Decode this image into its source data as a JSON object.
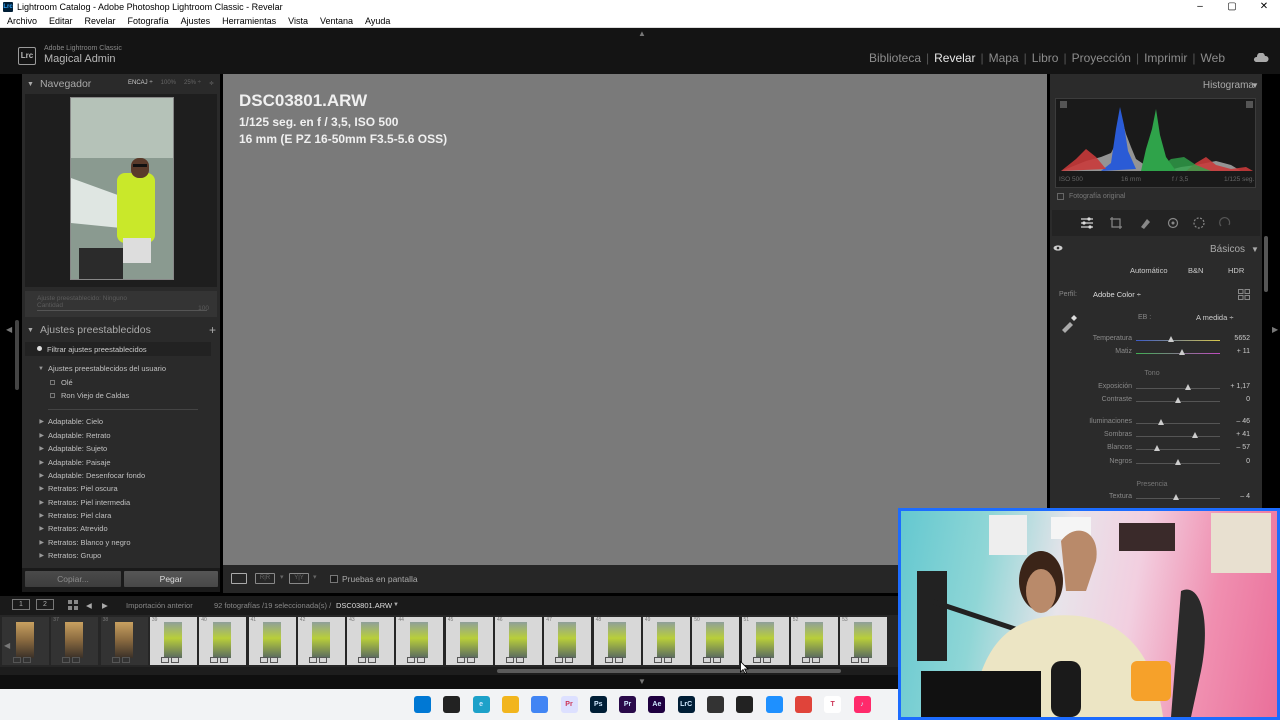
{
  "window": {
    "title": "Lightroom Catalog - Adobe Photoshop Lightroom Classic - Revelar",
    "app_icon": "Lrc",
    "controls": [
      "–",
      "▢",
      "✕"
    ]
  },
  "menu": [
    "Archivo",
    "Editar",
    "Revelar",
    "Fotografía",
    "Ajustes",
    "Herramientas",
    "Vista",
    "Ventana",
    "Ayuda"
  ],
  "identity": {
    "badge": "Lrc",
    "subtitle": "Adobe Lightroom Classic",
    "name": "Magical Admin"
  },
  "modules": [
    "Biblioteca",
    "Revelar",
    "Mapa",
    "Libro",
    "Proyección",
    "Imprimir",
    "Web"
  ],
  "active_module": "Revelar",
  "navigator": {
    "title": "Navegador",
    "zoom_options": [
      "ENCAJ ÷",
      "100%",
      "25% ÷"
    ]
  },
  "preset_amount": {
    "label1": "Ajuste preestablecido:",
    "value1": "Ninguno",
    "label2": "Cantidad",
    "value2": "100"
  },
  "presets": {
    "title": "Ajustes preestablecidos",
    "add": "+",
    "filter": "Filtrar ajustes preestablecidos",
    "user_group": "Ajustes preestablecidos del usuario",
    "user_items": [
      "Olé",
      "Ron Viejo de Caldas"
    ],
    "groups": [
      "Adaptable: Cielo",
      "Adaptable: Retrato",
      "Adaptable: Sujeto",
      "Adaptable: Paisaje",
      "Adaptable: Desenfocar fondo",
      "Retratos: Piel oscura",
      "Retratos: Piel intermedia",
      "Retratos: Piel clara",
      "Retratos: Atrevido",
      "Retratos: Blanco y negro",
      "Retratos: Grupo"
    ]
  },
  "buttons": {
    "copy": "Copiar...",
    "paste": "Pegar"
  },
  "photo_info": {
    "filename": "DSC03801.ARW",
    "exposure": "1/125 seg. en f / 3,5, ISO 500",
    "lens": "16 mm (E PZ 16-50mm F3.5-5.6 OSS)"
  },
  "toolbar": {
    "proof_label": "Pruebas en pantalla",
    "view_buttons": [
      "▭",
      "R|R",
      "Y|Y"
    ]
  },
  "histogram": {
    "title": "Histograma",
    "info": [
      "ISO 500",
      "16 mm",
      "f / 3,5",
      "1/125 seg."
    ],
    "original_photo": "Fotografía original"
  },
  "basic": {
    "title": "Básicos",
    "modes": [
      "Automático",
      "B&N",
      "HDR"
    ],
    "profile_label": "Perfil:",
    "profile_value": "Adobe Color ÷",
    "wb_label": "EB :",
    "wb_value": "A medida ÷",
    "tone_label": "Tono",
    "presence_label": "Presencia",
    "sliders": [
      {
        "label": "Temperatura",
        "value": "5652",
        "pos": 0.42
      },
      {
        "label": "Matiz",
        "value": "+ 11",
        "pos": 0.55
      },
      {
        "label": "Exposición",
        "value": "+ 1,17",
        "pos": 0.62
      },
      {
        "label": "Contraste",
        "value": "0",
        "pos": 0.5
      },
      {
        "label": "Iluminaciones",
        "value": "– 46",
        "pos": 0.3
      },
      {
        "label": "Sombras",
        "value": "+ 41",
        "pos": 0.7
      },
      {
        "label": "Blancos",
        "value": "– 57",
        "pos": 0.25
      },
      {
        "label": "Negros",
        "value": "0",
        "pos": 0.5
      },
      {
        "label": "Textura",
        "value": "– 4",
        "pos": 0.48
      }
    ]
  },
  "filmstrip": {
    "source": "Importación anterior",
    "count": "92 fotografías /19 seleccionada(s) /",
    "current": "DSC03801.ARW",
    "views": [
      "1",
      "2"
    ],
    "numbers": [
      "",
      "37",
      "38",
      "39",
      "40",
      "41",
      "42",
      "43",
      "44",
      "45",
      "46",
      "47",
      "48",
      "49",
      "50",
      "51",
      "52",
      "53"
    ],
    "selected_from": 3
  },
  "taskbar_apps": [
    {
      "name": "windows-start",
      "label": "",
      "color": "#0078d4"
    },
    {
      "name": "file-manager",
      "label": "",
      "color": "#222222"
    },
    {
      "name": "edge",
      "label": "e",
      "color": "#1da1c9"
    },
    {
      "name": "folder",
      "label": "",
      "color": "#f2b51d"
    },
    {
      "name": "chrome",
      "label": "",
      "color": "#4285f4"
    },
    {
      "name": "premiere-rush",
      "label": "Pr",
      "color": "#dde0ff"
    },
    {
      "name": "photoshop",
      "label": "Ps",
      "color": "#001e36"
    },
    {
      "name": "premiere",
      "label": "Pr",
      "color": "#2a0a4a"
    },
    {
      "name": "after-effects",
      "label": "Ae",
      "color": "#1f0040"
    },
    {
      "name": "lightroom-classic",
      "label": "LrC",
      "color": "#001e36"
    },
    {
      "name": "davinci",
      "label": "",
      "color": "#333333"
    },
    {
      "name": "obs",
      "label": "",
      "color": "#222222"
    },
    {
      "name": "sync",
      "label": "",
      "color": "#1e90ff"
    },
    {
      "name": "vr",
      "label": "",
      "color": "#e0443a"
    },
    {
      "name": "text-tool",
      "label": "T",
      "color": "#ffffff"
    },
    {
      "name": "tiktok",
      "label": "♪",
      "color": "#ff2a6b"
    }
  ]
}
